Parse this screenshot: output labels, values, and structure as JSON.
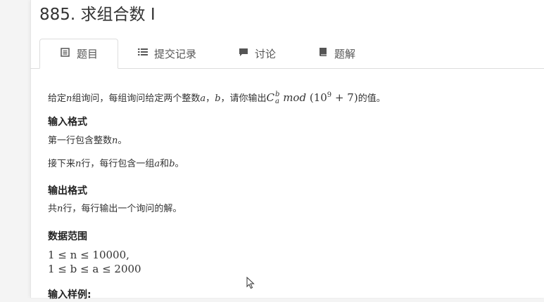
{
  "problem": {
    "title": "885. 求组合数 I"
  },
  "tabs": [
    {
      "label": "题目",
      "icon": "document-icon",
      "active": true
    },
    {
      "label": "提交记录",
      "icon": "list-icon",
      "active": false
    },
    {
      "label": "讨论",
      "icon": "chat-icon",
      "active": false
    },
    {
      "label": "题解",
      "icon": "book-icon",
      "active": false
    }
  ],
  "statement": {
    "intro_prefix": "给定",
    "intro_n": "n",
    "intro_mid": "组询问，每组询问给定两个整数",
    "intro_a": "a",
    "intro_sep": "，",
    "intro_b": "b",
    "intro_mid2": "，请你输出",
    "intro_formula_C": "C",
    "intro_formula_sup": "b",
    "intro_formula_sub": "a",
    "intro_formula_mod": "mod",
    "intro_formula_paren": "(10",
    "intro_formula_exp": "9",
    "intro_formula_tail": "+ 7)",
    "intro_suffix": "的值。"
  },
  "input_format": {
    "heading": "输入格式",
    "line1_prefix": "第一行包含整数",
    "line1_var": "n",
    "line1_suffix": "。",
    "line2_prefix": "接下来",
    "line2_var": "n",
    "line2_mid": "行，每行包含一组",
    "line2_a": "a",
    "line2_and": "和",
    "line2_b": "b",
    "line2_suffix": "。"
  },
  "output_format": {
    "heading": "输出格式",
    "line_prefix": "共",
    "line_var": "n",
    "line_suffix": "行，每行输出一个询问的解。"
  },
  "data_range": {
    "heading": "数据范围",
    "line1": "1 ≤ n ≤ 10000,",
    "line2": "1 ≤ b ≤ a ≤ 2000"
  },
  "sample": {
    "heading": "输入样例:"
  }
}
